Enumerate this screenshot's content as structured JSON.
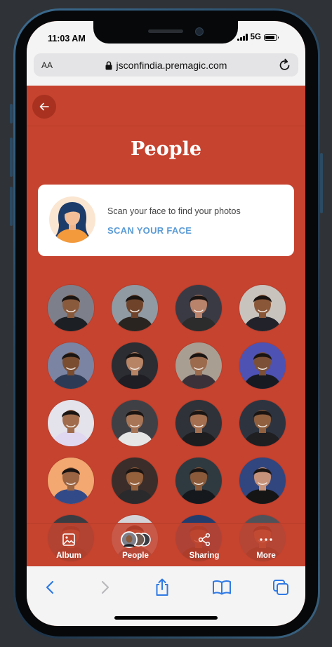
{
  "status_bar": {
    "time": "11:03 AM",
    "network": "5G"
  },
  "browser": {
    "text_size_label": "AA",
    "url": "jsconfindia.premagic.com"
  },
  "page": {
    "title": "People",
    "scan_card": {
      "prompt": "Scan your face to find your photos",
      "action": "SCAN YOUR FACE"
    }
  },
  "people_grid": {
    "faces": [
      {
        "bg": "#7d808a",
        "skin": "#8a5a3c",
        "shirt": "#1c1f24"
      },
      {
        "bg": "#8f9aa3",
        "skin": "#6e432a",
        "shirt": "#2a2420"
      },
      {
        "bg": "#3a3a44",
        "skin": "#b9826a",
        "shirt": "#2c2c2c"
      },
      {
        "bg": "#c9c3bd",
        "skin": "#8a5738",
        "shirt": "#22232a"
      },
      {
        "bg": "#7b84a2",
        "skin": "#7a4c30",
        "shirt": "#2d3a55"
      },
      {
        "bg": "#2b2d33",
        "skin": "#b78466",
        "shirt": "#1e1e24"
      },
      {
        "bg": "#a99e92",
        "skin": "#9c6a4d",
        "shirt": "#3a3238"
      },
      {
        "bg": "#4e52b3",
        "skin": "#7b5036",
        "shirt": "#181a22"
      },
      {
        "bg": "#e4e2ea",
        "skin": "#a06c4c",
        "shirt": "#e0d7f0"
      },
      {
        "bg": "#3f4046",
        "skin": "#a87656",
        "shirt": "#e6e6e6"
      },
      {
        "bg": "#2f3238",
        "skin": "#a36f50",
        "shirt": "#1d1d20"
      },
      {
        "bg": "#2d3440",
        "skin": "#90603f",
        "shirt": "#1f1f22"
      },
      {
        "bg": "#f2a870",
        "skin": "#9b6443",
        "shirt": "#334a88"
      },
      {
        "bg": "#3b2e2a",
        "skin": "#95603c",
        "shirt": "#2a2a2d"
      },
      {
        "bg": "#2e3a40",
        "skin": "#8a5a3a",
        "shirt": "#15181d"
      },
      {
        "bg": "#31467f",
        "skin": "#c7927a",
        "shirt": "#151515"
      },
      {
        "bg": "#3a3c42",
        "skin": "#8e5c3b",
        "shirt": "#2a2b30"
      },
      {
        "bg": "#d4d4d8",
        "skin": "#9e6b4a",
        "shirt": "#5c5c66"
      },
      {
        "bg": "#223c6e",
        "skin": "#7c5136",
        "shirt": "#1a1a1a"
      },
      {
        "bg": "#50525a",
        "skin": "#a27050",
        "shirt": "#2a2a2a"
      }
    ]
  },
  "tab_bar": {
    "tabs": [
      {
        "label": "Album",
        "icon": "image-icon"
      },
      {
        "label": "People",
        "icon": "people-avatars-icon"
      },
      {
        "label": "Sharing",
        "icon": "share-icon"
      },
      {
        "label": "More",
        "icon": "more-dots-icon"
      }
    ]
  },
  "browser_toolbar": {
    "icons": [
      "back-chevron-icon",
      "forward-chevron-icon",
      "share-icon",
      "bookmarks-icon",
      "tabs-icon"
    ]
  }
}
